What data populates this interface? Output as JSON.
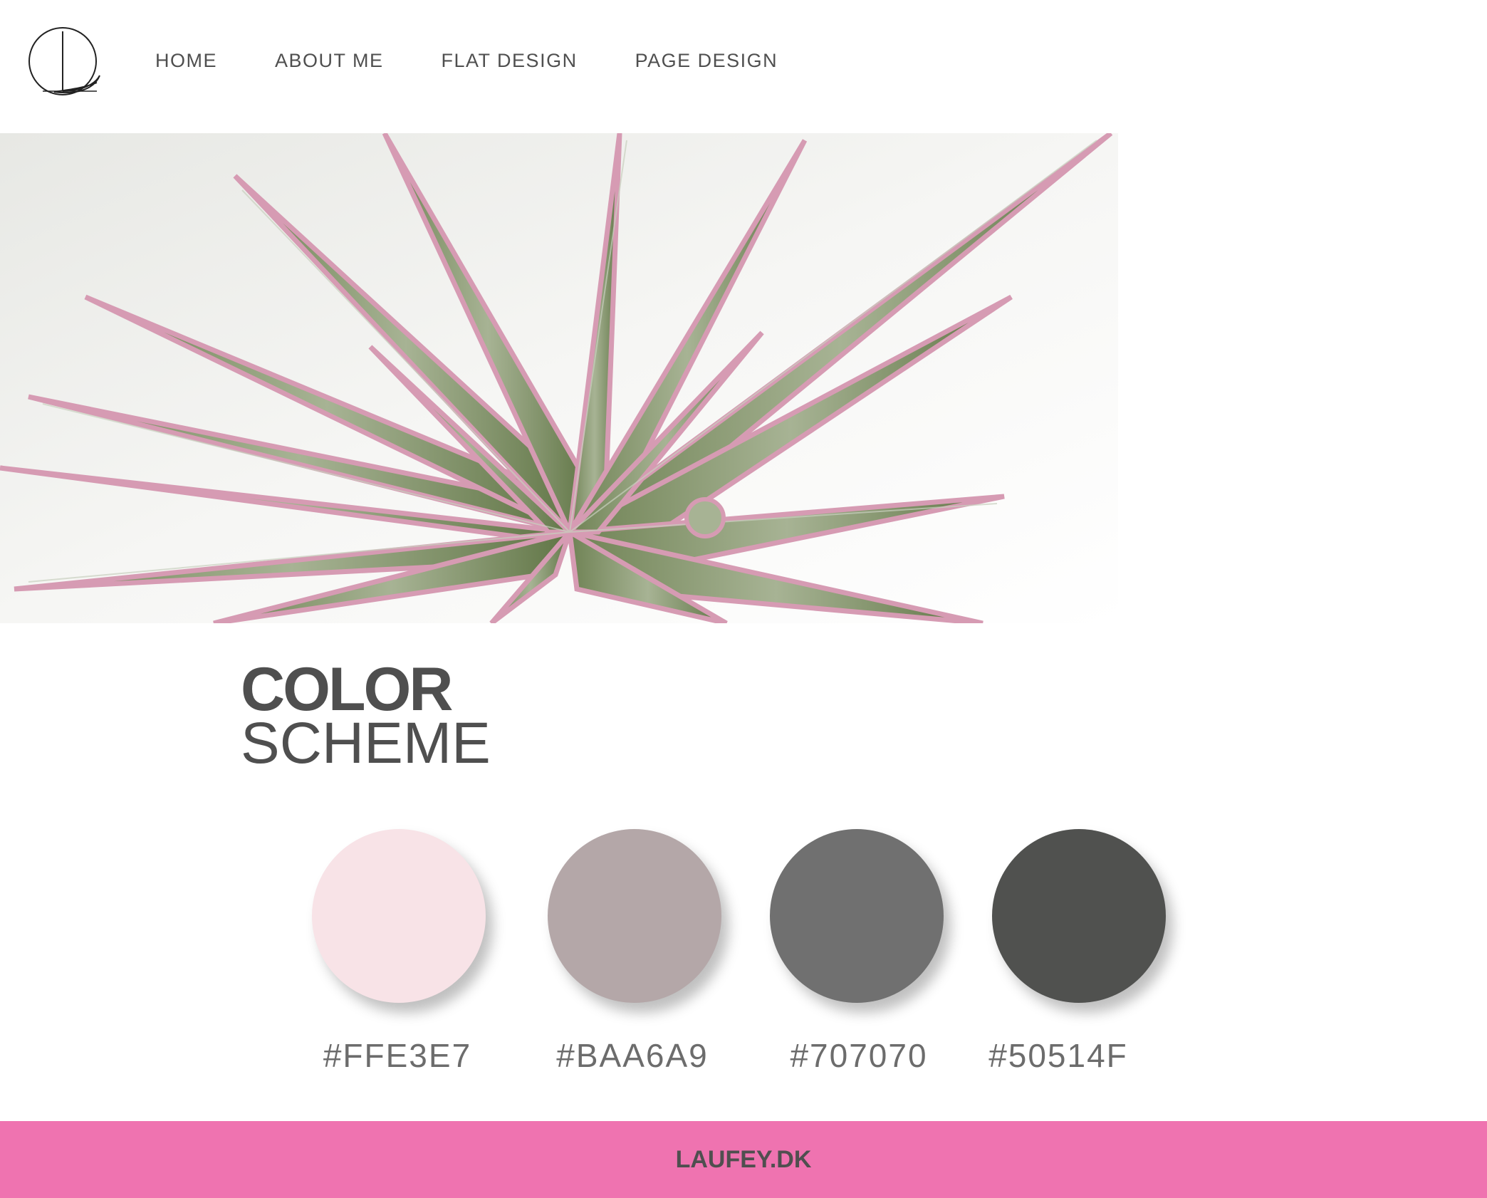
{
  "header": {
    "logo_icon": "monogram-circle-logo",
    "nav": [
      "HOME",
      "ABOUT ME",
      "FLAT DESIGN",
      "PAGE DESIGN"
    ]
  },
  "hero": {
    "image": "succulent-plant-photo"
  },
  "section": {
    "title_bold": "COLOR",
    "title_light": "SCHEME"
  },
  "swatches": [
    {
      "color": "#F8E3E7",
      "label": "#FFE3E7"
    },
    {
      "color": "#B4A7A8",
      "label": "#BAA6A9"
    },
    {
      "color": "#707070",
      "label": "#707070"
    },
    {
      "color": "#50514F",
      "label": "#50514F"
    }
  ],
  "footer": {
    "text": "LAUFEY.DK",
    "color": "#EF73B0"
  }
}
